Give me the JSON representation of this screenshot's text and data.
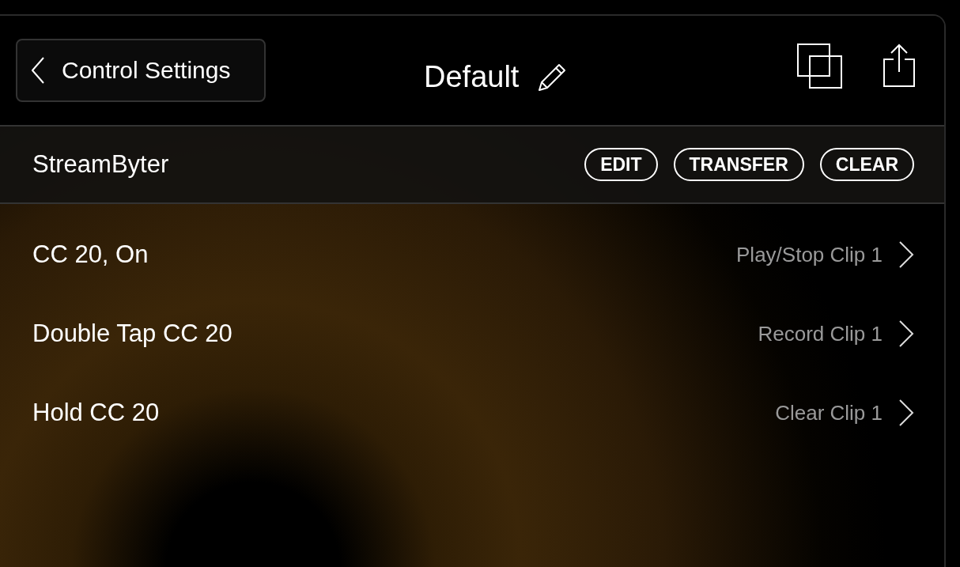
{
  "header": {
    "back_label": "Control Settings",
    "title": "Default"
  },
  "section": {
    "title": "StreamByter",
    "buttons": [
      "EDIT",
      "TRANSFER",
      "CLEAR"
    ]
  },
  "rows": [
    {
      "label": "CC 20, On",
      "value": "Play/Stop Clip 1"
    },
    {
      "label": "Double Tap CC 20",
      "value": "Record Clip 1"
    },
    {
      "label": "Hold CC 20",
      "value": "Clear Clip 1"
    }
  ]
}
